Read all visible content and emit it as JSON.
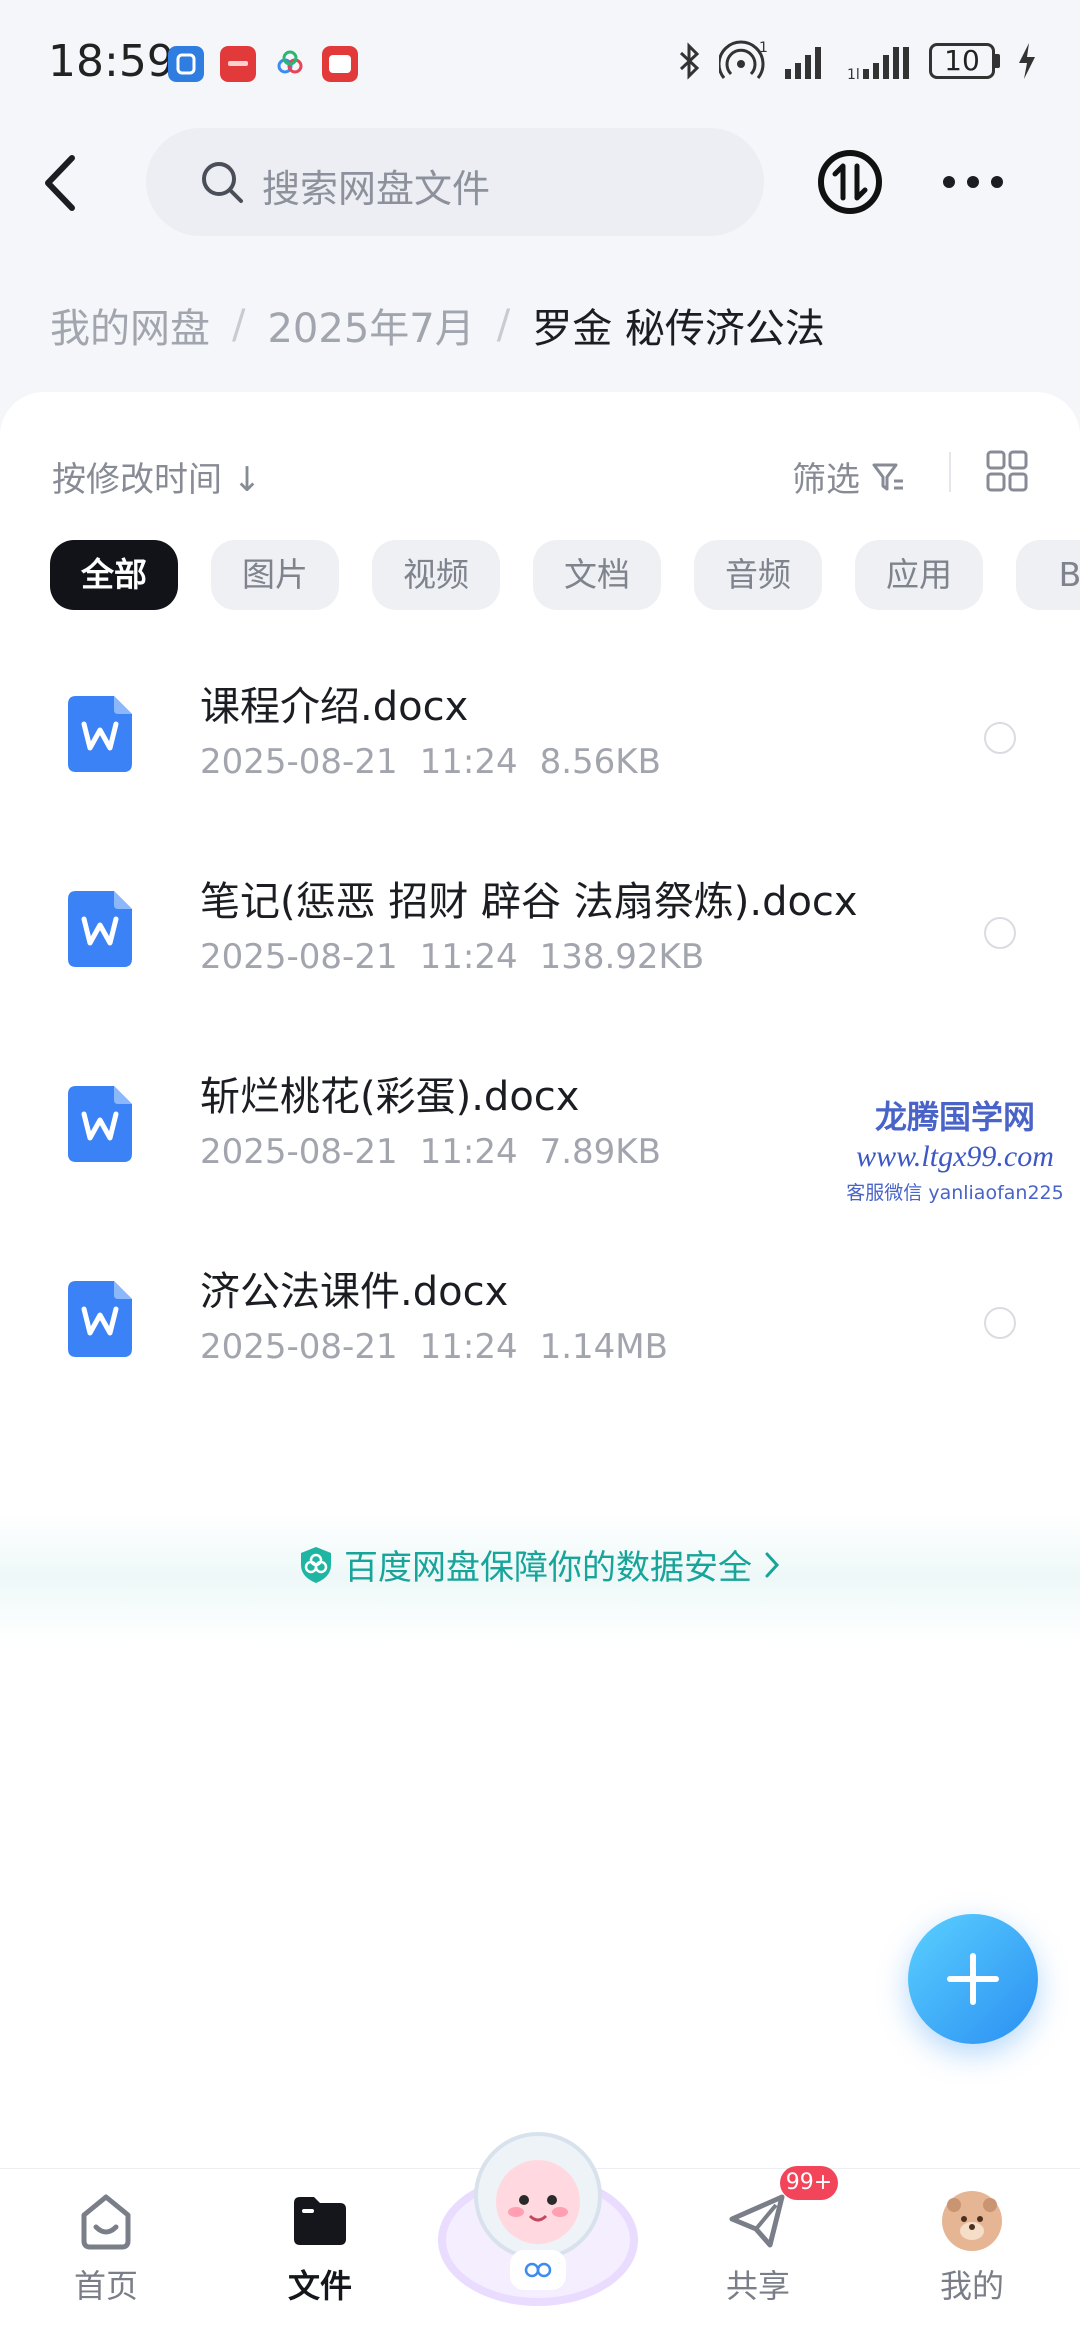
{
  "status_bar": {
    "time": "18:59",
    "battery": "10"
  },
  "header": {
    "search_placeholder": "搜索网盘文件"
  },
  "breadcrumb": {
    "items": [
      "我的网盘",
      "2025年7月"
    ],
    "current": "罗金 秘传济公法"
  },
  "toolbar": {
    "sort_label": "按修改时间",
    "sort_arrow": "↓",
    "filter_label": "筛选"
  },
  "filter_chips": [
    "全部",
    "图片",
    "视频",
    "文档",
    "音频",
    "应用",
    "BT"
  ],
  "files": [
    {
      "name": "课程介绍.docx",
      "date": "2025-08-21",
      "time": "11:24",
      "size": "8.56KB"
    },
    {
      "name": "笔记(惩恶 招财 辟谷 法扇祭炼).docx",
      "date": "2025-08-21",
      "time": "11:24",
      "size": "138.92KB"
    },
    {
      "name": "斩烂桃花(彩蛋).docx",
      "date": "2025-08-21",
      "time": "11:24",
      "size": "7.89KB"
    },
    {
      "name": "济公法课件.docx",
      "date": "2025-08-21",
      "time": "11:24",
      "size": "1.14MB"
    }
  ],
  "watermark": {
    "title": "龙腾国学网",
    "url": "www.ltgx99.com",
    "wechat": "客服微信 yanliaofan225"
  },
  "security_notice": "百度网盘保障你的数据安全",
  "bottom_nav": [
    {
      "label": "首页",
      "icon": "home-icon"
    },
    {
      "label": "文件",
      "icon": "folder-icon"
    },
    {
      "label": "共享",
      "icon": "share-icon"
    },
    {
      "label": "我的",
      "icon": "avatar-icon"
    }
  ],
  "share_badge": "99+",
  "colors": {
    "accent": "#2b8ff2",
    "doc_icon": "#3b82f6",
    "security": "#17a59a",
    "badge": "#f2455a"
  }
}
